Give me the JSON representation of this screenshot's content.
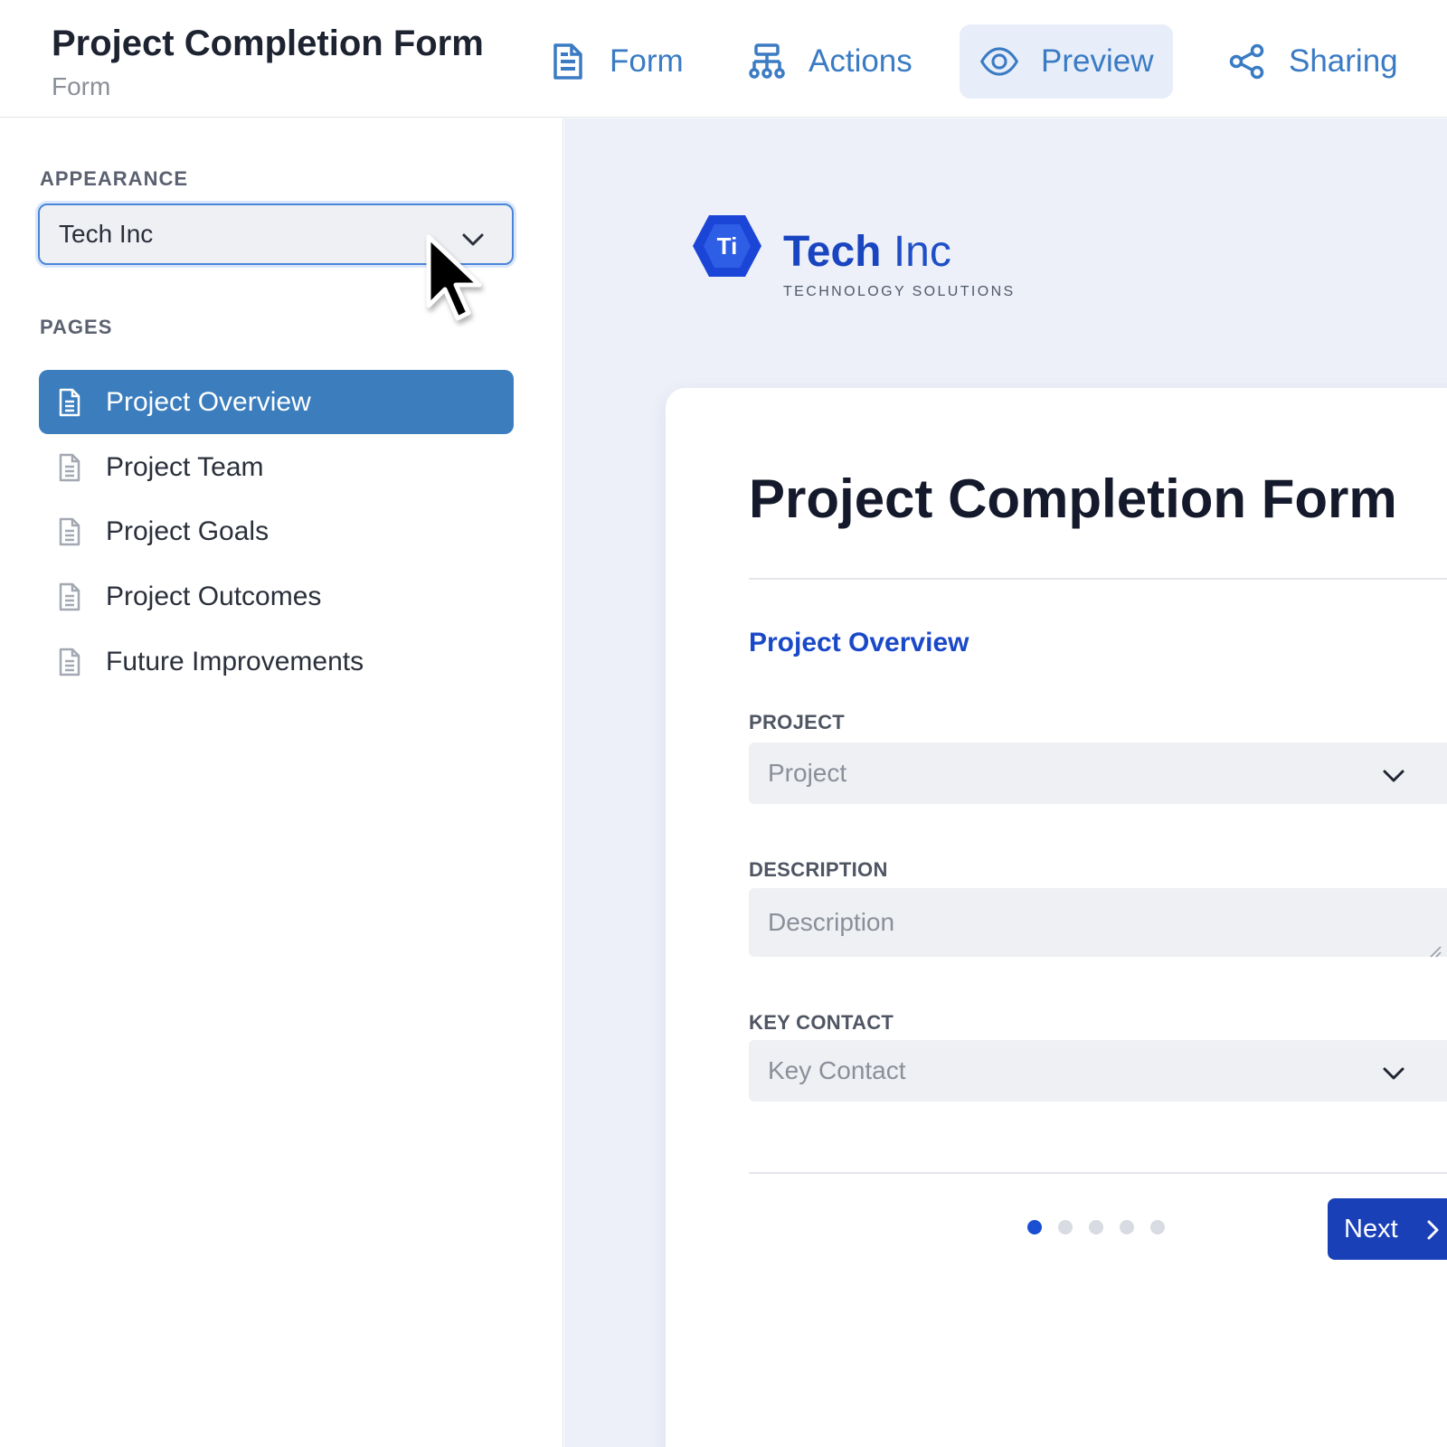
{
  "header": {
    "title": "Project Completion Form",
    "subtitle": "Form",
    "tabs": [
      {
        "label": "Form",
        "icon": "document-icon"
      },
      {
        "label": "Actions",
        "icon": "workflow-icon"
      },
      {
        "label": "Preview",
        "icon": "eye-icon",
        "active": true
      },
      {
        "label": "Sharing",
        "icon": "share-icon"
      }
    ]
  },
  "sidebar": {
    "appearance_label": "APPEARANCE",
    "appearance_value": "Tech Inc",
    "pages_label": "PAGES",
    "pages": [
      {
        "label": "Project Overview",
        "active": true
      },
      {
        "label": "Project Team"
      },
      {
        "label": "Project Goals"
      },
      {
        "label": "Project Outcomes"
      },
      {
        "label": "Future Improvements"
      }
    ]
  },
  "preview": {
    "brand": {
      "bold": "Tech",
      "light": "Inc",
      "tagline": "TECHNOLOGY SOLUTIONS",
      "logo_text": "Ti"
    },
    "form_title": "Project Completion Form",
    "section_title": "Project Overview",
    "fields": [
      {
        "label": "PROJECT",
        "placeholder": "Project",
        "type": "select"
      },
      {
        "label": "DESCRIPTION",
        "placeholder": "Description",
        "type": "textarea"
      },
      {
        "label": "KEY CONTACT",
        "placeholder": "Key Contact",
        "type": "select"
      }
    ],
    "pagination": {
      "current": 1,
      "total": 5
    },
    "next_label": "Next"
  },
  "colors": {
    "accent": "#3a7bc4",
    "active_page": "#3b7dbd",
    "brand_blue": "#1a45c0",
    "next_button": "#1a40b8",
    "preview_bg": "#edf0f9"
  }
}
